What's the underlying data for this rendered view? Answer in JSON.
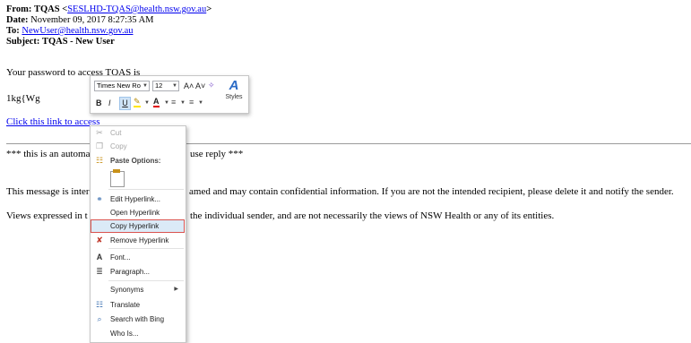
{
  "email": {
    "from_label": "From:",
    "from_name": "TQAS <",
    "from_email": "SESLHD-TQAS@health.nsw.gov.au",
    "from_close": ">",
    "date_label": "Date:",
    "date_value": "November 09, 2017 8:27:35 AM",
    "to_label": "To:",
    "to_email": "NewUser@health.nsw.gov.au",
    "subject_label": "Subject:",
    "subject_value": "TQAS - New User",
    "line_password": "Your password to access TQAS is",
    "line_code": "1kg{Wg",
    "line_link": "Click this link to access",
    "line_auto_start": "*** this is an automa",
    "line_auto_end": "use reply ***",
    "line_msg_start": "This message is inter",
    "line_msg_end": "amed and may contain confidential information. If you are not the intended recipient, please delete it and notify the sender.",
    "line_views_start": "Views expressed in t",
    "line_views_end": "the individual sender, and are not necessarily the views of NSW Health or any of its entities."
  },
  "mini_toolbar": {
    "font_name": "Times New Ro",
    "font_size": "12",
    "bold": "B",
    "italic": "I",
    "underline": "U",
    "grow": "A˄",
    "shrink": "A˅",
    "styles_label": "Styles",
    "styles_glyph": "A"
  },
  "context_menu": {
    "items": [
      {
        "label": "Cut",
        "icon": "scissors-icon",
        "glyph": "✂"
      },
      {
        "label": "Copy",
        "icon": "copy-icon",
        "glyph": "❐"
      },
      {
        "label": "Paste Options:",
        "icon": "paste-icon",
        "glyph": "☷"
      },
      {
        "label": "Edit Hyperlink...",
        "icon": "edit-hyperlink-icon",
        "glyph": "⚭"
      },
      {
        "label": "Open Hyperlink",
        "icon": "open-hyperlink-icon",
        "glyph": ""
      },
      {
        "label": "Copy Hyperlink",
        "icon": "copy-hyperlink-icon",
        "glyph": ""
      },
      {
        "label": "Remove Hyperlink",
        "icon": "remove-hyperlink-icon",
        "glyph": "✘"
      },
      {
        "label": "Font...",
        "icon": "font-icon",
        "glyph": "A"
      },
      {
        "label": "Paragraph...",
        "icon": "paragraph-icon",
        "glyph": "≣"
      },
      {
        "label": "Synonyms",
        "icon": "synonyms-icon",
        "glyph": ""
      },
      {
        "label": "Translate",
        "icon": "translate-icon",
        "glyph": "☷"
      },
      {
        "label": "Search with Bing",
        "icon": "search-icon",
        "glyph": "⌕"
      },
      {
        "label": "Who Is...",
        "icon": "who-is-icon",
        "glyph": ""
      }
    ]
  }
}
